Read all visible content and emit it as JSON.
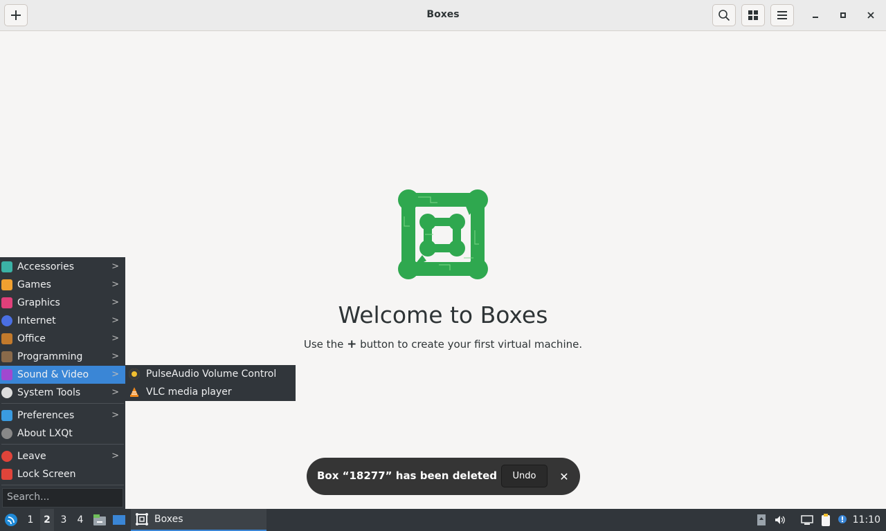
{
  "window": {
    "title": "Boxes"
  },
  "welcome": {
    "heading": "Welcome to Boxes",
    "hint_prefix": "Use the",
    "hint_plus": "+",
    "hint_suffix": "button to create your first virtual machine."
  },
  "toast": {
    "message": "Box “18277” has been deleted",
    "undo_label": "Undo",
    "close_glyph": "✕"
  },
  "menu": {
    "items": [
      {
        "label": "Accessories",
        "icon": "accessories-icon",
        "color": "#3bb2a6"
      },
      {
        "label": "Games",
        "icon": "games-icon",
        "color": "#f0a030"
      },
      {
        "label": "Graphics",
        "icon": "graphics-icon",
        "color": "#e0407a"
      },
      {
        "label": "Internet",
        "icon": "internet-icon",
        "color": "#4a6fe3"
      },
      {
        "label": "Office",
        "icon": "office-icon",
        "color": "#c27a2c"
      },
      {
        "label": "Programming",
        "icon": "programming-icon",
        "color": "#8a6a4a"
      },
      {
        "label": "Sound & Video",
        "icon": "sound-video-icon",
        "color": "#a048d0"
      },
      {
        "label": "System Tools",
        "icon": "system-tools-icon",
        "color": "#dddddd"
      },
      {
        "label": "Preferences",
        "icon": "preferences-icon",
        "color": "#3a9be0"
      },
      {
        "label": "About LXQt",
        "icon": "info-icon",
        "color": "#888888"
      },
      {
        "label": "Leave",
        "icon": "power-icon",
        "color": "#e0443a"
      },
      {
        "label": "Lock Screen",
        "icon": "lock-icon",
        "color": "#e0443a"
      }
    ],
    "search_placeholder": "Search...",
    "submenu": [
      {
        "label": "PulseAudio Volume Control",
        "icon": "pulseaudio-icon"
      },
      {
        "label": "VLC media player",
        "icon": "vlc-icon"
      }
    ]
  },
  "taskbar": {
    "desktops": [
      "1",
      "2",
      "3",
      "4"
    ],
    "active_desktop": "2",
    "task_label": "Boxes",
    "clock": "11:10"
  },
  "colors": {
    "accent": "#3a86d6",
    "boxes_green": "#2fa84f"
  }
}
